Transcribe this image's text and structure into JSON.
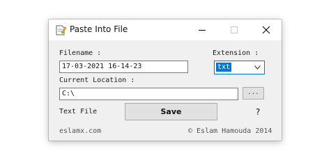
{
  "window": {
    "title": "Paste Into File",
    "icons": {
      "app": "notepad-pen-icon",
      "minimize": "minimize-icon",
      "maximize": "maximize-icon",
      "close": "close-icon"
    }
  },
  "form": {
    "filename_label": "Filename :",
    "filename_value": "17-03-2021 16-14-23",
    "extension_label": "Extension :",
    "extension_value": "txt",
    "location_label": "Current Location :",
    "location_value": "C:\\",
    "browse_label": "...",
    "file_type_label": "Text File",
    "save_label": "Save",
    "help_label": "?"
  },
  "footer": {
    "website": "eslamx.com",
    "copyright": "© Eslam Hamouda 2014"
  },
  "colors": {
    "accent": "#0078d7",
    "background": "#f0f0f0"
  }
}
